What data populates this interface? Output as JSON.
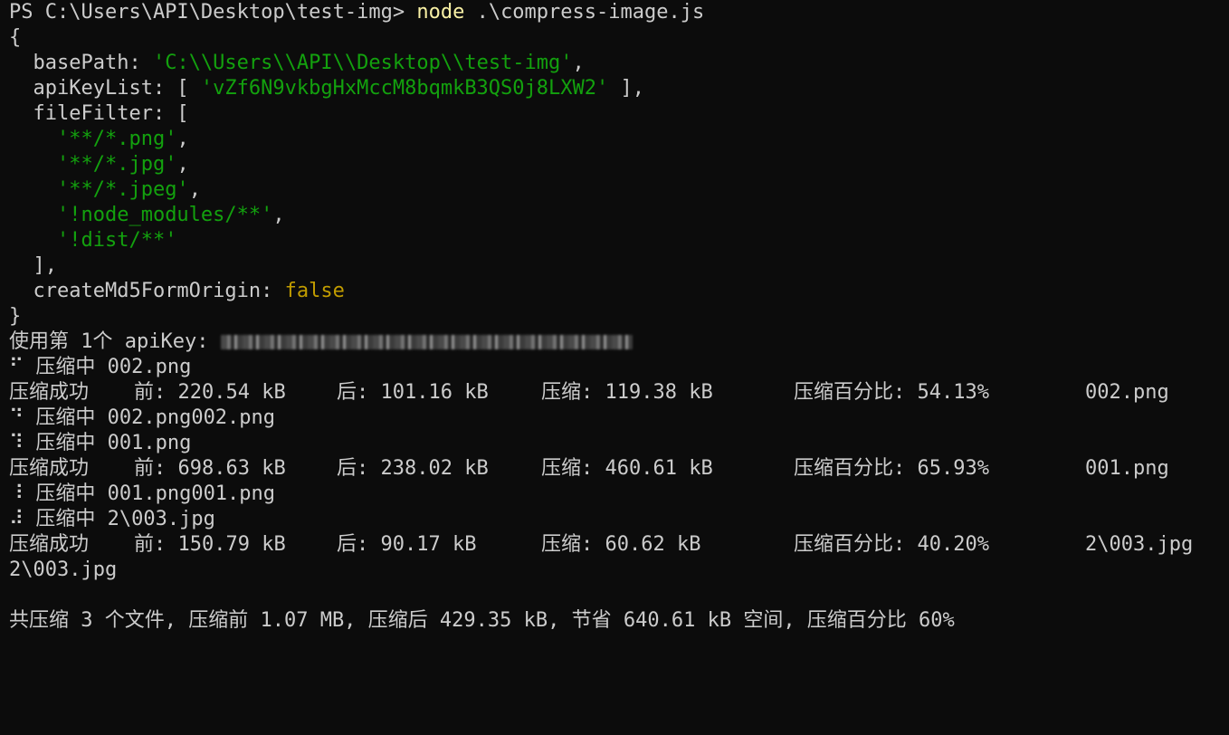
{
  "prompt": {
    "text": "PS C:\\Users\\API\\Desktop\\test-img> ",
    "command": "node",
    "args": " .\\compress-image.js"
  },
  "config": {
    "open_brace": "{",
    "basePath_key": "  basePath: ",
    "basePath_value": "'C:\\\\Users\\\\API\\\\Desktop\\\\test-img'",
    "basePath_comma": ",",
    "apiKeyList_key": "  apiKeyList: [ ",
    "apiKeyList_value": "'vZf6N9vkbgHxMccM8bqmkB3QS0j8LXW2'",
    "apiKeyList_end": " ],",
    "fileFilter_key": "  fileFilter: [",
    "filters": [
      {
        "indent": "    ",
        "value": "'**/*.png'",
        "suffix": ","
      },
      {
        "indent": "    ",
        "value": "'**/*.jpg'",
        "suffix": ","
      },
      {
        "indent": "    ",
        "value": "'**/*.jpeg'",
        "suffix": ","
      },
      {
        "indent": "    ",
        "value": "'!node_modules/**'",
        "suffix": ","
      },
      {
        "indent": "    ",
        "value": "'!dist/**'",
        "suffix": ""
      }
    ],
    "fileFilter_end": "  ],",
    "createMd5_key": "  createMd5FormOrigin: ",
    "createMd5_value": "false",
    "close_brace": "}"
  },
  "apikey_line": {
    "label": "使用第 1个 apiKey: "
  },
  "log": [
    {
      "type": "progress",
      "text": "⠋ 压缩中 002.png"
    },
    {
      "type": "result",
      "status": "压缩成功",
      "before": "前: 220.54 kB",
      "after": "后: 101.16 kB",
      "saved": "压缩: 119.38 kB",
      "percent": "压缩百分比: 54.13%",
      "file": "002.png"
    },
    {
      "type": "progress",
      "text": "⠙ 压缩中 002.png002.png"
    },
    {
      "type": "progress",
      "text": "⠹ 压缩中 001.png"
    },
    {
      "type": "result",
      "status": "压缩成功",
      "before": "前: 698.63 kB",
      "after": "后: 238.02 kB",
      "saved": "压缩: 460.61 kB",
      "percent": "压缩百分比: 65.93%",
      "file": "001.png"
    },
    {
      "type": "progress",
      "text": "⠸ 压缩中 001.png001.png"
    },
    {
      "type": "progress",
      "text": "⠼ 压缩中 2\\003.jpg"
    },
    {
      "type": "result",
      "status": "压缩成功",
      "before": "前: 150.79 kB",
      "after": "后: 90.17 kB",
      "saved": "压缩: 60.62 kB",
      "percent": "压缩百分比: 40.20%",
      "file": "2\\003.jpg"
    },
    {
      "type": "plain",
      "text": "2\\003.jpg"
    }
  ],
  "summary": "共压缩 3 个文件, 压缩前 1.07 MB, 压缩后 429.35 kB, 节省 640.61 kB 空间, 压缩百分比 60%",
  "colors": {
    "background": "#0c0c0c",
    "foreground": "#cccccc",
    "command": "#f9f1a5",
    "string": "#13a10e",
    "boolean": "#c19c00"
  }
}
